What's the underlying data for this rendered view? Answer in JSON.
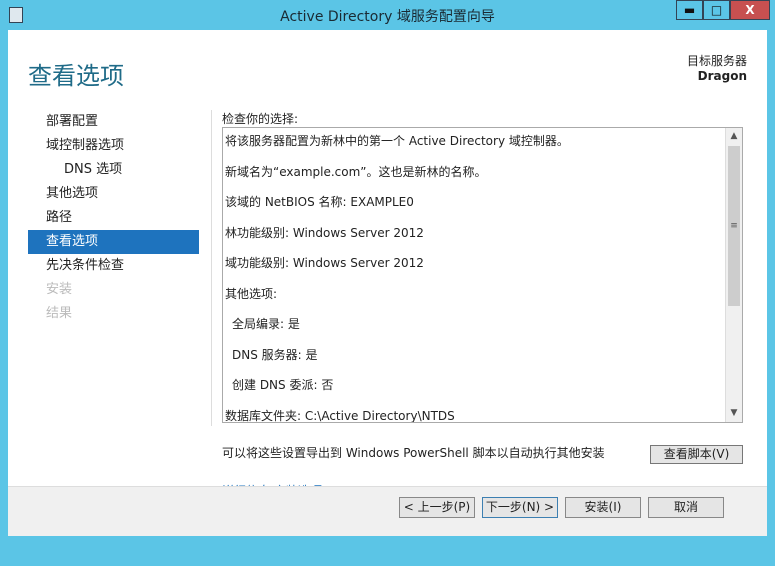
{
  "window": {
    "title": "Active Directory 域服务配置向导",
    "minimize": "▬",
    "maximize": "□",
    "close": "X"
  },
  "header": {
    "page_title": "查看选项",
    "target_label": "目标服务器",
    "target_name": "Dragon"
  },
  "nav": [
    {
      "label": "部署配置"
    },
    {
      "label": "域控制器选项"
    },
    {
      "label": "DNS 选项"
    },
    {
      "label": "其他选项"
    },
    {
      "label": "路径"
    },
    {
      "label": "查看选项"
    },
    {
      "label": "先决条件检查"
    },
    {
      "label": "安装"
    },
    {
      "label": "结果"
    }
  ],
  "review": {
    "label": "检查你的选择:",
    "lines": [
      "将该服务器配置为新林中的第一个 Active Directory 域控制器。",
      "新域名为“example.com”。这也是新林的名称。",
      "该域的 NetBIOS 名称: EXAMPLE0",
      "林功能级别: Windows Server 2012",
      "域功能级别: Windows Server 2012",
      "其他选项:",
      "全局编录: 是",
      "DNS 服务器: 是",
      "创建 DNS 委派: 否",
      "数据库文件夹: C:\\Active Directory\\NTDS"
    ]
  },
  "export": {
    "text": "可以将这些设置导出到 Windows PowerShell 脚本以自动执行其他安装",
    "button": "查看脚本(V)"
  },
  "links": {
    "more": "详细信息 安装选项"
  },
  "footer": {
    "prev": "< 上一步(P)",
    "next": "下一步(N) >",
    "install": "安装(I)",
    "cancel": "取消"
  }
}
